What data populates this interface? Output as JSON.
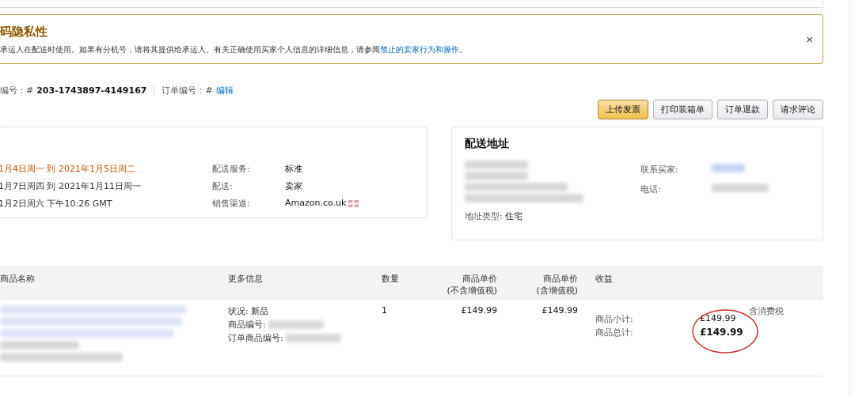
{
  "notice": {
    "title": "码隐私性",
    "text": "承运人在配送时使用。如果有分机号，请将其提供给承运人。有关正确使用买家个人信息的详细信息，请参阅",
    "link": "禁止的卖家行为和操作",
    "text_end": "。",
    "close": "×"
  },
  "order": {
    "label": "编号：#",
    "number": "203-1743897-4149167",
    "seller_label": "订单编号：#",
    "seller_link": "编辑"
  },
  "buttons": [
    {
      "label": "上传发票",
      "primary": true
    },
    {
      "label": "打印装箱单",
      "primary": false
    },
    {
      "label": "订单退款",
      "primary": false
    },
    {
      "label": "请求评论",
      "primary": false
    }
  ],
  "shipping": {
    "dates": [
      {
        "text": "1月4日周一 到 2021年1月5日周二",
        "highlight": true
      },
      {
        "text": "1月7日周四 到 2021年1月11日周一",
        "highlight": false
      },
      {
        "text": "1月2日周六 下午10:26 GMT",
        "highlight": false
      }
    ],
    "fields": [
      {
        "label": "配送服务:",
        "value": "标准",
        "flag": false
      },
      {
        "label": "配送:",
        "value": "卖家",
        "flag": false
      },
      {
        "label": "销售渠道:",
        "value": "Amazon.co.uk",
        "flag": true
      }
    ]
  },
  "address": {
    "title": "配送地址",
    "contact_label": "联系买家:",
    "phone_label": "电话:",
    "type_label": "地址类型:",
    "type_value": "住宅"
  },
  "table": {
    "columns": [
      "商品名称",
      "更多信息",
      "数量",
      "商品单价\n(不含增值税)",
      "商品单价\n(含增值税)",
      "收益"
    ],
    "rows": [
      {
        "info": [
          {
            "label": "状况:",
            "value": "新品"
          },
          {
            "label": "商品编号:"
          },
          {
            "label": "订单商品编号:"
          }
        ],
        "quantity": "1",
        "price_ex": "£149.99",
        "price_inc": "£149.99",
        "income": [
          {
            "label": "商品小计:",
            "value": "£149.99",
            "bold": false
          },
          {
            "label": "商品总计:",
            "value": "£149.99",
            "bold": true
          }
        ],
        "tax_note": "含消费税",
        "circled": true
      }
    ]
  }
}
